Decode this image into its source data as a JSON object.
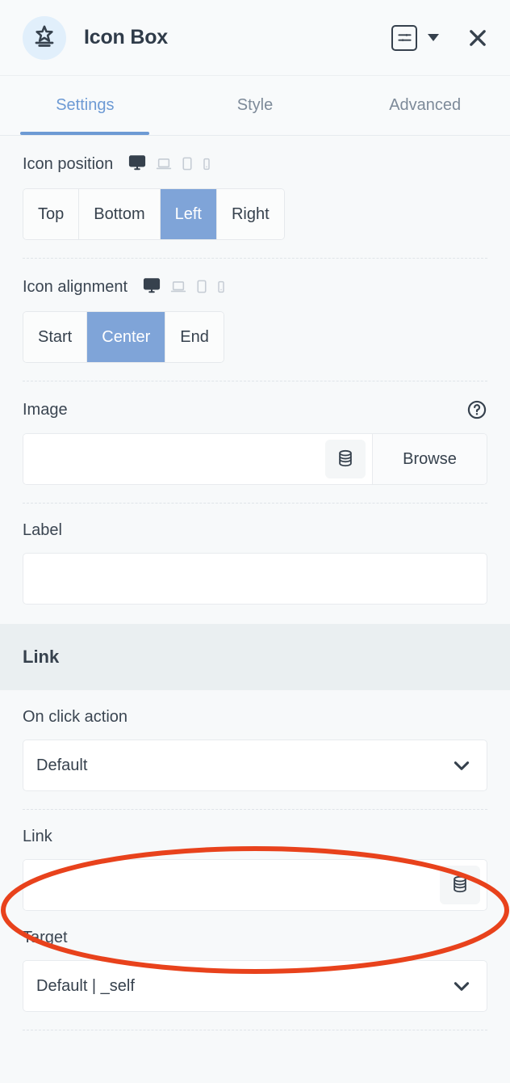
{
  "header": {
    "title": "Icon Box",
    "widget_icon": "star-box-icon",
    "settings_icon": "sliders-icon",
    "dropdown_icon": "caret-down-icon",
    "close_icon": "close-icon"
  },
  "tabs": [
    {
      "label": "Settings",
      "active": true
    },
    {
      "label": "Style",
      "active": false
    },
    {
      "label": "Advanced",
      "active": false
    }
  ],
  "responsive_icons": [
    {
      "name": "desktop-icon",
      "active": true
    },
    {
      "name": "laptop-icon",
      "active": false
    },
    {
      "name": "tablet-icon",
      "active": false
    },
    {
      "name": "mobile-icon",
      "active": false
    }
  ],
  "fields": {
    "icon_position": {
      "label": "Icon position",
      "options": [
        "Top",
        "Bottom",
        "Left",
        "Right"
      ],
      "selected": "Left"
    },
    "icon_alignment": {
      "label": "Icon alignment",
      "options": [
        "Start",
        "Center",
        "End"
      ],
      "selected": "Center"
    },
    "image": {
      "label": "Image",
      "value": "",
      "placeholder": "",
      "help_icon": "help-circle-icon",
      "dynamic_icon": "database-icon",
      "browse_label": "Browse"
    },
    "label": {
      "label": "Label",
      "value": "",
      "placeholder": ""
    }
  },
  "link_section": {
    "title": "Link",
    "on_click_action": {
      "label": "On click action",
      "value": "Default"
    },
    "link": {
      "label": "Link",
      "value": "",
      "placeholder": "",
      "dynamic_icon": "database-icon"
    },
    "target": {
      "label": "Target",
      "value": "Default | _self"
    }
  },
  "annotation": {
    "type": "ellipse-highlight",
    "color": "#e8421c",
    "target": "link-input"
  },
  "colors": {
    "accent_blue": "#7fa4d8",
    "tab_active": "#6d9ad4",
    "text": "#36414d",
    "panel_bg": "#f7f9fa",
    "band_bg": "#eaeff1",
    "badge_bg": "#e1effb",
    "annotation": "#e8421c"
  }
}
